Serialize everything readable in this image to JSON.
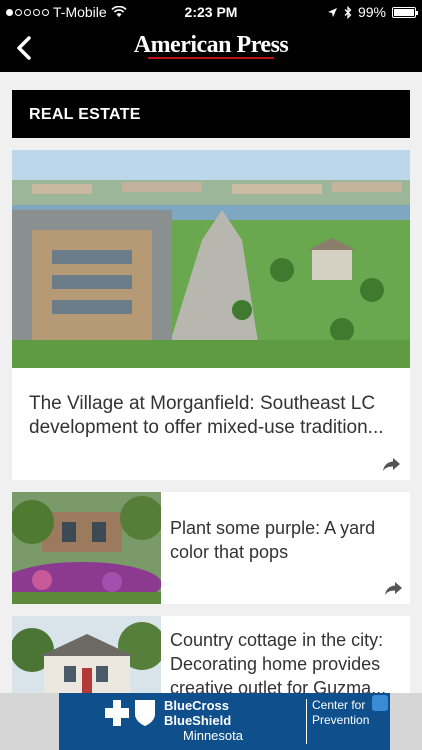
{
  "status_bar": {
    "carrier": "T-Mobile",
    "time": "2:23 PM",
    "battery": "99%",
    "signal_bars_filled": 1,
    "signal_bars_total": 5,
    "battery_level": 0.99
  },
  "nav": {
    "logo": "American Press"
  },
  "section": {
    "title": "REAL ESTATE"
  },
  "articles": [
    {
      "title": "The Village at Morganfield: Southeast LC development to offer mixed-use tradition..."
    },
    {
      "title": "Plant some purple: A yard color that pops"
    },
    {
      "title": "Country cottage in the city: Decorating home provides creative outlet for Guzma..."
    }
  ],
  "ad": {
    "brand_line1": "BlueCross",
    "brand_line2": "BlueShield",
    "region": "Minnesota",
    "tagline_line1": "Center for",
    "tagline_line2": "Prevention"
  },
  "colors": {
    "bar_background": "#000000",
    "card_background": "#ffffff",
    "page_background": "#f0f0f0",
    "ad_background": "#0f4f8c",
    "logo_accent": "#c0121a"
  },
  "icons": {
    "back": "chevron-left-icon",
    "share": "share-arrow-icon",
    "wifi": "wifi-icon",
    "location": "location-arrow-icon",
    "bluetooth": "bluetooth-icon",
    "battery": "battery-icon"
  }
}
